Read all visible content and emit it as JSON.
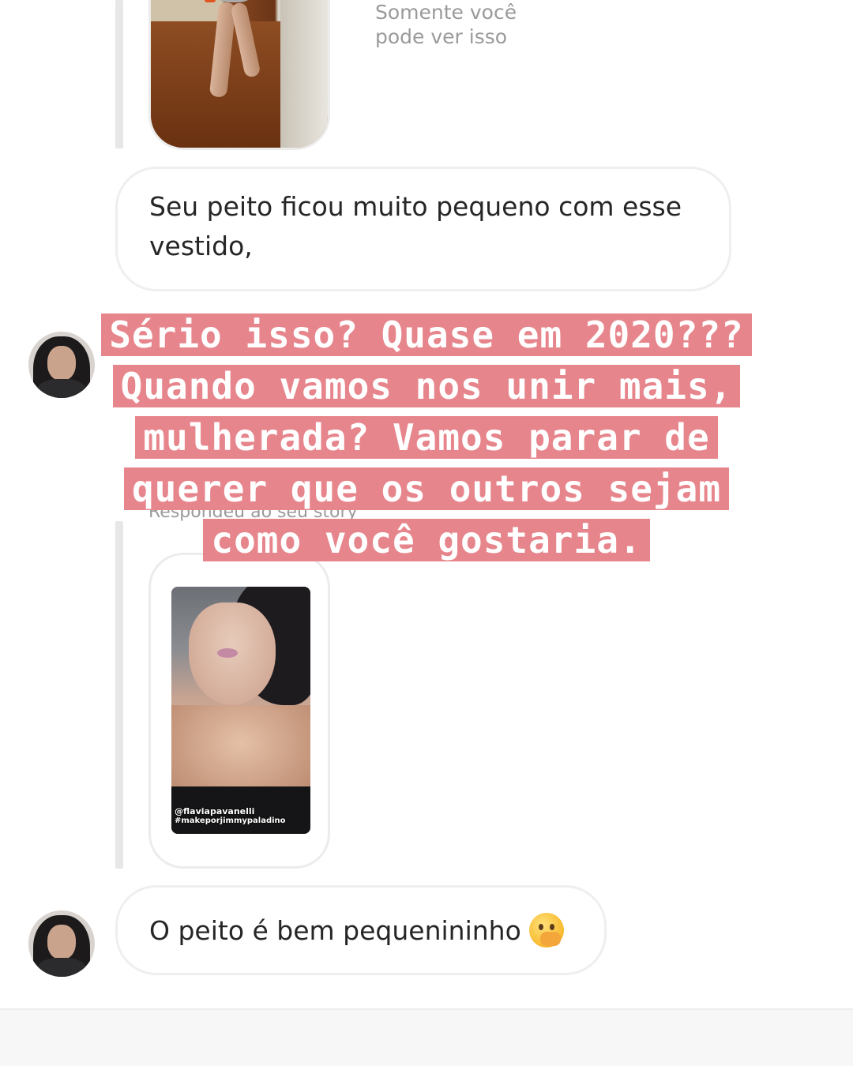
{
  "story_top": {
    "visibility_note": "Somente você\npode ver isso"
  },
  "messages": [
    {
      "id": "m1",
      "text": "Seu peito ficou muito pequeno com esse vestido,"
    },
    {
      "id": "m2",
      "text": "O peito é bem pequenininho"
    }
  ],
  "story_bottom": {
    "replied_label": "Respondeu ao seu story",
    "tag_line_1": "@flaviapavanelli",
    "tag_line_2": "#makeporjimmypaladino"
  },
  "caption": {
    "lines": [
      "Sério isso? Quase em 2020???",
      "Quando vamos nos unir mais,",
      "mulherada? Vamos parar de",
      "querer que os outros sejam",
      "como você gostaria."
    ],
    "highlight_color": "#e7858c"
  },
  "icons": {
    "emoji": "face-with-hand-over-mouth-icon",
    "avatar": "profile-avatar"
  }
}
